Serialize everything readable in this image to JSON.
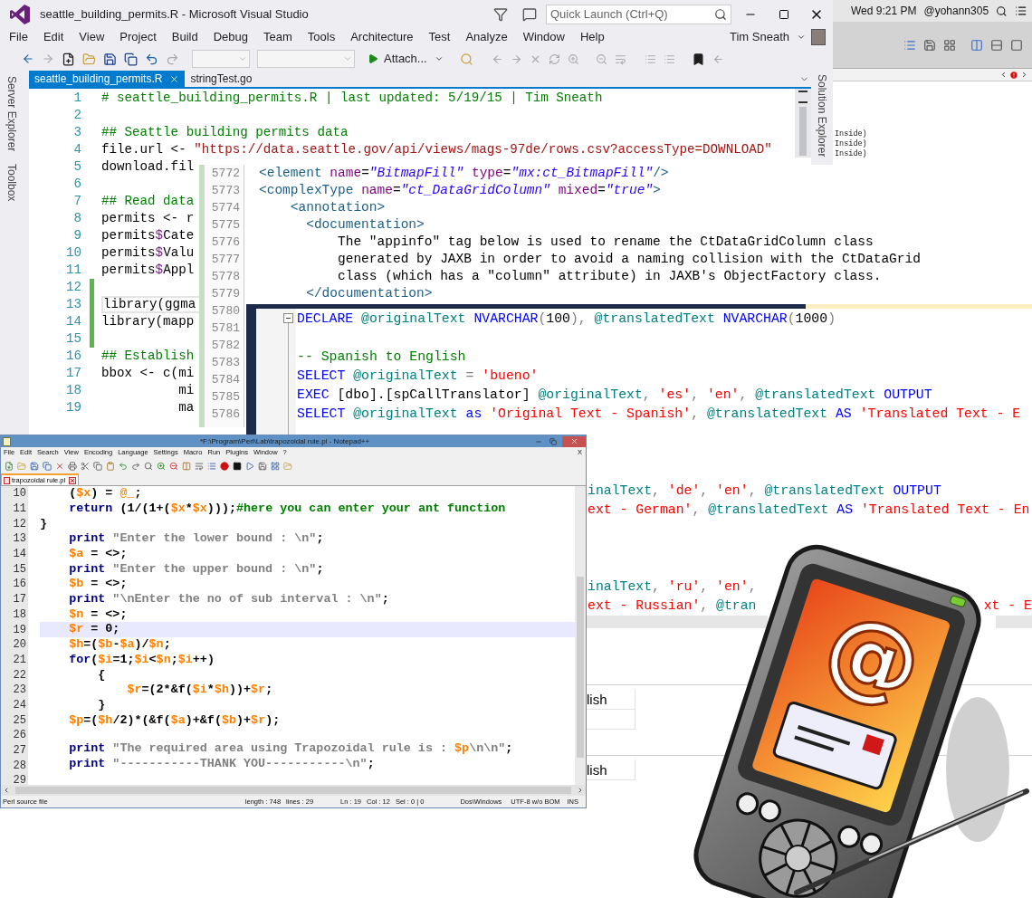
{
  "visual_studio": {
    "title": "seattle_building_permits.R - Microsoft Visual Studio",
    "quick_launch": {
      "placeholder": "Quick Launch (Ctrl+Q)"
    },
    "menu": [
      "File",
      "Edit",
      "View",
      "Project",
      "Build",
      "Debug",
      "Team",
      "Tools",
      "Architecture",
      "Test",
      "Analyze",
      "Window",
      "Help"
    ],
    "user": "Tim Sneath",
    "toolbar": {
      "attach": "Attach..."
    },
    "side_tabs_left": [
      "Server Explorer",
      "Toolbox"
    ],
    "side_tabs_right": [
      "Solution Explorer"
    ],
    "tabs": [
      {
        "label": "seattle_building_permits.R",
        "selected": true
      },
      {
        "label": "stringTest.go",
        "selected": false
      }
    ],
    "lines": [
      {
        "number": "1",
        "changed": false,
        "current": false,
        "tokens": [
          {
            "kind": "comment",
            "text": "# seattle_building_permits.R | last updated: 5/19/15 | Tim Sneath"
          }
        ]
      },
      {
        "number": "2",
        "changed": false,
        "current": false
      },
      {
        "number": "3",
        "changed": false,
        "current": false,
        "tokens": [
          {
            "kind": "comment",
            "text": "## Seattle building permits data"
          }
        ]
      },
      {
        "number": "4",
        "changed": false,
        "current": false,
        "tokens": [
          {
            "kind": "plain",
            "text": "file.url <- "
          },
          {
            "kind": "string",
            "text": "\"https://data.seattle.gov/api/views/mags-97de/rows.csv?accessType=DOWNLOAD\""
          }
        ]
      },
      {
        "number": "5",
        "changed": false,
        "current": false,
        "tokens": [
          {
            "kind": "plain",
            "text": "download.fil"
          }
        ]
      },
      {
        "number": "6",
        "changed": false,
        "current": false
      },
      {
        "number": "7",
        "changed": false,
        "current": false,
        "tokens": [
          {
            "kind": "comment",
            "text": "## Read data"
          }
        ]
      },
      {
        "number": "8",
        "changed": false,
        "current": false,
        "tokens": [
          {
            "kind": "plain",
            "text": "permits <- r"
          }
        ]
      },
      {
        "number": "9",
        "changed": false,
        "current": false,
        "tokens": [
          {
            "kind": "plain",
            "text": "permits"
          },
          {
            "kind": "sigil",
            "text": "$"
          },
          {
            "kind": "plain",
            "text": "Cate"
          }
        ]
      },
      {
        "number": "10",
        "changed": false,
        "current": false,
        "tokens": [
          {
            "kind": "plain",
            "text": "permits"
          },
          {
            "kind": "sigil",
            "text": "$"
          },
          {
            "kind": "plain",
            "text": "Valu"
          }
        ]
      },
      {
        "number": "11",
        "changed": false,
        "current": false,
        "tokens": [
          {
            "kind": "plain",
            "text": "permits"
          },
          {
            "kind": "sigil",
            "text": "$"
          },
          {
            "kind": "plain",
            "text": "Appl"
          }
        ]
      },
      {
        "number": "12",
        "changed": true,
        "current": false
      },
      {
        "number": "13",
        "changed": true,
        "current": true,
        "tokens": [
          {
            "kind": "plain",
            "text": "library(ggma"
          }
        ]
      },
      {
        "number": "14",
        "changed": true,
        "current": false,
        "tokens": [
          {
            "kind": "plain",
            "text": "library(mapp"
          }
        ]
      },
      {
        "number": "15",
        "changed": true,
        "current": false
      },
      {
        "number": "16",
        "changed": false,
        "current": false,
        "tokens": [
          {
            "kind": "comment",
            "text": "## Establish"
          }
        ]
      },
      {
        "number": "17",
        "changed": false,
        "current": false,
        "tokens": [
          {
            "kind": "plain",
            "text": "bbox <- c(mi"
          }
        ]
      },
      {
        "number": "18",
        "changed": false,
        "current": false,
        "tokens": [
          {
            "kind": "plain",
            "text": "          mi"
          }
        ]
      },
      {
        "number": "19",
        "changed": false,
        "current": false,
        "tokens": [
          {
            "kind": "plain",
            "text": "          ma"
          }
        ]
      }
    ]
  },
  "mac_panel": {
    "clock": "Wed 9:21 PM",
    "user": "@yohann305",
    "code_fragments": [
      "Inside)",
      "Inside)",
      "Inside)"
    ]
  },
  "xml_editor": {
    "line_numbers": [
      "5772",
      "5773",
      "5774",
      "5775",
      "5776",
      "5777",
      "5778",
      "5779",
      "5780",
      "5781",
      "5782",
      "5783",
      "5784",
      "5785",
      "5786"
    ],
    "lines": [
      {
        "tokens": [
          {
            "kind": "tag",
            "text": "<element "
          },
          {
            "kind": "attr",
            "text": "name"
          },
          {
            "kind": "plain",
            "text": "="
          },
          {
            "kind": "value",
            "text": "\"BitmapFill\" "
          },
          {
            "kind": "attr",
            "text": "type"
          },
          {
            "kind": "plain",
            "text": "="
          },
          {
            "kind": "value",
            "text": "\"mx:ct_BitmapFill\""
          },
          {
            "kind": "tag",
            "text": "/>"
          }
        ]
      },
      {
        "tokens": [
          {
            "kind": "tag",
            "text": "<complexType "
          },
          {
            "kind": "attr",
            "text": "name"
          },
          {
            "kind": "plain",
            "text": "="
          },
          {
            "kind": "value",
            "text": "\"ct_DataGridColumn\" "
          },
          {
            "kind": "attr",
            "text": "mixed"
          },
          {
            "kind": "plain",
            "text": "="
          },
          {
            "kind": "value",
            "text": "\"true\""
          },
          {
            "kind": "tag",
            "text": ">"
          }
        ]
      },
      {
        "tokens": [
          {
            "kind": "tag",
            "text": "    <annotation>"
          }
        ]
      },
      {
        "tokens": [
          {
            "kind": "tag",
            "text": "      <documentation>"
          }
        ]
      },
      {
        "tokens": [
          {
            "kind": "plain",
            "text": "          The \"appinfo\" tag below is used to rename the CtDataGridColumn class"
          }
        ]
      },
      {
        "tokens": [
          {
            "kind": "plain",
            "text": "          generated by JAXB in order to avoid a naming collision with the CtDataGrid"
          }
        ]
      },
      {
        "tokens": [
          {
            "kind": "plain",
            "text": "          class (which has a \"column\" attribute) in JAXB's ObjectFactory class."
          }
        ]
      },
      {
        "tokens": [
          {
            "kind": "tag",
            "text": "      </documentation>"
          }
        ]
      }
    ]
  },
  "sql_editor": {
    "lines": [
      {
        "kind": "full",
        "tokens": [
          {
            "kind": "keyword",
            "text": "DECLARE "
          },
          {
            "kind": "var",
            "text": "@originalText "
          },
          {
            "kind": "keyword",
            "text": "NVARCHAR"
          },
          {
            "kind": "punct",
            "text": "("
          },
          {
            "kind": "plain",
            "text": "100"
          },
          {
            "kind": "punct",
            "text": "), "
          },
          {
            "kind": "var",
            "text": "@translatedText "
          },
          {
            "kind": "keyword",
            "text": "NVARCHAR"
          },
          {
            "kind": "punct",
            "text": "("
          },
          {
            "kind": "plain",
            "text": "1000"
          },
          {
            "kind": "punct",
            "text": ")"
          }
        ]
      },
      {
        "kind": "blank"
      },
      {
        "kind": "full",
        "tokens": [
          {
            "kind": "comment",
            "text": "-- Spanish to English"
          }
        ]
      },
      {
        "kind": "full",
        "tokens": [
          {
            "kind": "keyword",
            "text": "SELECT "
          },
          {
            "kind": "var",
            "text": "@originalText "
          },
          {
            "kind": "punct",
            "text": "= "
          },
          {
            "kind": "string",
            "text": "'bueno'"
          }
        ]
      },
      {
        "kind": "full",
        "tokens": [
          {
            "kind": "keyword",
            "text": "EXEC "
          },
          {
            "kind": "plain",
            "text": "[dbo].[spCallTranslator] "
          },
          {
            "kind": "var",
            "text": "@originalText"
          },
          {
            "kind": "punct",
            "text": ", "
          },
          {
            "kind": "string",
            "text": "'es'"
          },
          {
            "kind": "punct",
            "text": ", "
          },
          {
            "kind": "string",
            "text": "'en'"
          },
          {
            "kind": "punct",
            "text": ", "
          },
          {
            "kind": "var",
            "text": "@translatedText "
          },
          {
            "kind": "keyword",
            "text": "OUTPUT"
          }
        ]
      },
      {
        "kind": "full",
        "tokens": [
          {
            "kind": "keyword",
            "text": "SELECT "
          },
          {
            "kind": "var",
            "text": "@originalText "
          },
          {
            "kind": "keyword",
            "text": "as "
          },
          {
            "kind": "string",
            "text": "'Original Text - Spanish'"
          },
          {
            "kind": "punct",
            "text": ", "
          },
          {
            "kind": "var",
            "text": "@translatedText "
          },
          {
            "kind": "keyword",
            "text": "AS "
          },
          {
            "kind": "string",
            "text": "'Translated Text - E"
          }
        ]
      },
      {
        "kind": "blank"
      },
      {
        "kind": "blank"
      },
      {
        "kind": "blank"
      },
      {
        "kind": "cut",
        "tokens": [
          {
            "kind": "var",
            "text": "inalText"
          },
          {
            "kind": "punct",
            "text": ", "
          },
          {
            "kind": "string",
            "text": "'de'"
          },
          {
            "kind": "punct",
            "text": ", "
          },
          {
            "kind": "string",
            "text": "'en'"
          },
          {
            "kind": "punct",
            "text": ", "
          },
          {
            "kind": "var",
            "text": "@translatedText "
          },
          {
            "kind": "keyword",
            "text": "OUTPUT"
          }
        ]
      },
      {
        "kind": "cut",
        "tokens": [
          {
            "kind": "string",
            "text": "ext - German'"
          },
          {
            "kind": "punct",
            "text": ", "
          },
          {
            "kind": "var",
            "text": "@translatedText "
          },
          {
            "kind": "keyword",
            "text": "AS "
          },
          {
            "kind": "string",
            "text": "'Translated Text - En"
          }
        ]
      },
      {
        "kind": "blank"
      },
      {
        "kind": "blank"
      },
      {
        "kind": "blank"
      },
      {
        "kind": "cut",
        "tokens": [
          {
            "kind": "var",
            "text": "inalText"
          },
          {
            "kind": "punct",
            "text": ", "
          },
          {
            "kind": "string",
            "text": "'ru'"
          },
          {
            "kind": "punct",
            "text": ", "
          },
          {
            "kind": "string",
            "text": "'en'"
          },
          {
            "kind": "punct",
            "text": ","
          }
        ]
      },
      {
        "kind": "cut",
        "tokens": [
          {
            "kind": "string",
            "text": "ext - Russian'"
          },
          {
            "kind": "punct",
            "text": ", "
          },
          {
            "kind": "var",
            "text": "@tran"
          }
        ],
        "tail": [
          {
            "kind": "string",
            "text": "xt - E"
          }
        ]
      }
    ],
    "results": [
      "lish",
      "lish"
    ]
  },
  "notepad": {
    "title": "*F:\\Program\\Perl\\Lab\\trapozoidal rule.pl - Notepad++",
    "menu": [
      "File",
      "Edit",
      "Search",
      "View",
      "Encoding",
      "Language",
      "Settings",
      "Macro",
      "Run",
      "Plugins",
      "Window",
      "?"
    ],
    "menu_close": "X",
    "tab": "trapozoidal rule.pl",
    "lines": [
      {
        "number": "10",
        "current": false,
        "tokens": [
          {
            "kind": "plain",
            "text": "    ("
          },
          {
            "kind": "var",
            "text": "$x"
          },
          {
            "kind": "plain",
            "text": ") = "
          },
          {
            "kind": "var",
            "text": "@_"
          },
          {
            "kind": "plain",
            "text": ";"
          }
        ]
      },
      {
        "number": "11",
        "current": false,
        "tokens": [
          {
            "kind": "keyword",
            "text": "    return"
          },
          {
            "kind": "plain",
            "text": " (1/(1+("
          },
          {
            "kind": "var",
            "text": "$x"
          },
          {
            "kind": "plain",
            "text": "*"
          },
          {
            "kind": "var",
            "text": "$x"
          },
          {
            "kind": "plain",
            "text": ")));"
          },
          {
            "kind": "comment",
            "text": "#here you can enter your ant function"
          }
        ]
      },
      {
        "number": "12",
        "current": false,
        "tokens": [
          {
            "kind": "plain",
            "text": "}"
          }
        ]
      },
      {
        "number": "13",
        "current": false,
        "tokens": [
          {
            "kind": "keyword",
            "text": "    print"
          },
          {
            "kind": "string",
            "text": " \"Enter the lower bound : \\n\""
          },
          {
            "kind": "plain",
            "text": ";"
          }
        ]
      },
      {
        "number": "14",
        "current": false,
        "tokens": [
          {
            "kind": "var",
            "text": "    $a"
          },
          {
            "kind": "plain",
            "text": " = <>;"
          }
        ]
      },
      {
        "number": "15",
        "current": false,
        "tokens": [
          {
            "kind": "keyword",
            "text": "    print"
          },
          {
            "kind": "string",
            "text": " \"Enter the upper bound : \\n\""
          },
          {
            "kind": "plain",
            "text": ";"
          }
        ]
      },
      {
        "number": "16",
        "current": false,
        "tokens": [
          {
            "kind": "var",
            "text": "    $b"
          },
          {
            "kind": "plain",
            "text": " = <>;"
          }
        ]
      },
      {
        "number": "17",
        "current": false,
        "tokens": [
          {
            "kind": "keyword",
            "text": "    print"
          },
          {
            "kind": "string",
            "text": " \"\\nEnter the no of sub interval : \\n\""
          },
          {
            "kind": "plain",
            "text": ";"
          }
        ]
      },
      {
        "number": "18",
        "current": false,
        "tokens": [
          {
            "kind": "var",
            "text": "    $n"
          },
          {
            "kind": "plain",
            "text": " = <>;"
          }
        ]
      },
      {
        "number": "19",
        "current": true,
        "tokens": [
          {
            "kind": "var",
            "text": "    $r"
          },
          {
            "kind": "plain",
            "text": " = 0;"
          }
        ]
      },
      {
        "number": "20",
        "current": false,
        "tokens": [
          {
            "kind": "var",
            "text": "    $h"
          },
          {
            "kind": "plain",
            "text": "=("
          },
          {
            "kind": "var",
            "text": "$b"
          },
          {
            "kind": "plain",
            "text": "-"
          },
          {
            "kind": "var",
            "text": "$a"
          },
          {
            "kind": "plain",
            "text": ")/"
          },
          {
            "kind": "var",
            "text": "$n"
          },
          {
            "kind": "plain",
            "text": ";"
          }
        ]
      },
      {
        "number": "21",
        "current": false,
        "tokens": [
          {
            "kind": "keyword",
            "text": "    for"
          },
          {
            "kind": "plain",
            "text": "("
          },
          {
            "kind": "var",
            "text": "$i"
          },
          {
            "kind": "plain",
            "text": "=1;"
          },
          {
            "kind": "var",
            "text": "$i"
          },
          {
            "kind": "plain",
            "text": "<"
          },
          {
            "kind": "var",
            "text": "$n"
          },
          {
            "kind": "plain",
            "text": ";"
          },
          {
            "kind": "var",
            "text": "$i"
          },
          {
            "kind": "plain",
            "text": "++)"
          }
        ]
      },
      {
        "number": "22",
        "current": false,
        "tokens": [
          {
            "kind": "plain",
            "text": "        {"
          }
        ]
      },
      {
        "number": "23",
        "current": false,
        "tokens": [
          {
            "kind": "var",
            "text": "            $r"
          },
          {
            "kind": "plain",
            "text": "=(2*&f("
          },
          {
            "kind": "var",
            "text": "$i"
          },
          {
            "kind": "plain",
            "text": "*"
          },
          {
            "kind": "var",
            "text": "$h"
          },
          {
            "kind": "plain",
            "text": "))+"
          },
          {
            "kind": "var",
            "text": "$r"
          },
          {
            "kind": "plain",
            "text": ";"
          }
        ]
      },
      {
        "number": "24",
        "current": false,
        "tokens": [
          {
            "kind": "plain",
            "text": "        }"
          }
        ]
      },
      {
        "number": "25",
        "current": false,
        "tokens": [
          {
            "kind": "var",
            "text": "    $p"
          },
          {
            "kind": "plain",
            "text": "=("
          },
          {
            "kind": "var",
            "text": "$h"
          },
          {
            "kind": "plain",
            "text": "/2)*(&f("
          },
          {
            "kind": "var",
            "text": "$a"
          },
          {
            "kind": "plain",
            "text": ")+&f("
          },
          {
            "kind": "var",
            "text": "$b"
          },
          {
            "kind": "plain",
            "text": ")+"
          },
          {
            "kind": "var",
            "text": "$r"
          },
          {
            "kind": "plain",
            "text": ");"
          }
        ]
      },
      {
        "number": "26",
        "current": false
      },
      {
        "number": "27",
        "current": false,
        "tokens": [
          {
            "kind": "keyword",
            "text": "    print"
          },
          {
            "kind": "string",
            "text": " \"The required area using Trapozoidal rule is : "
          },
          {
            "kind": "var",
            "text": "$p"
          },
          {
            "kind": "string",
            "text": "\\n\\n\""
          },
          {
            "kind": "plain",
            "text": ";"
          }
        ]
      },
      {
        "number": "28",
        "current": false,
        "tokens": [
          {
            "kind": "keyword",
            "text": "    print"
          },
          {
            "kind": "string",
            "text": " \"-----------THANK YOU-----------\\n\""
          },
          {
            "kind": "plain",
            "text": ";"
          }
        ]
      },
      {
        "number": "29",
        "current": false
      }
    ],
    "status": {
      "file_type": "Perl source file",
      "length": "length : 748",
      "lines": "lines : 29",
      "ln": "Ln : 19",
      "col": "Col : 12",
      "sel": "Sel : 0 | 0",
      "eol": "Dos\\Windows",
      "encoding": "UTF-8 w/o BOM",
      "mode": "INS"
    }
  },
  "device": {
    "screen_symbol": "@"
  }
}
